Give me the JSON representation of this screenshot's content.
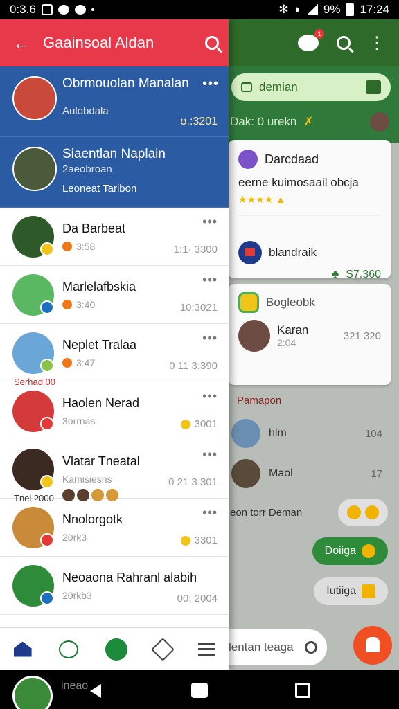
{
  "status_bar": {
    "time_left": "0:3.6",
    "battery_percent": "9%",
    "time_right": "17:24"
  },
  "drawer": {
    "title": "Gaainsoal Aldan",
    "highlighted": [
      {
        "name": "Obrmouolan Manalan",
        "sub": "Aulobdala",
        "meta": "ʊ.:3201"
      },
      {
        "name": "Siaentlan Naplain",
        "sub": "2aeobroan",
        "sub2": "Leoneat Taribon"
      }
    ],
    "items": [
      {
        "name": "Da Barbeat",
        "sub": "3:58",
        "time": "1:1· 3300"
      },
      {
        "name": "Marlelafbskia",
        "sub": "3:40",
        "time": "10:3021"
      },
      {
        "name": "Neplet Tralaa",
        "sub": "3:47",
        "time": "0 11 3:390",
        "tag": "Serhad 00"
      },
      {
        "name": "Haolen Nerad",
        "sub": "3orrnas",
        "time": "3001"
      },
      {
        "name": "Vlatar Tneatal",
        "sub": "Kamisiesns",
        "time": "0 21 3 301",
        "tag": "Tnel 2000"
      },
      {
        "name": "Nnolorgotk",
        "sub": "20rk3",
        "time": "3301"
      },
      {
        "name": "Neoaona Rahranl alabih",
        "sub": "20rkb3",
        "time": "00: 2004"
      }
    ]
  },
  "background_app": {
    "pill_label": "demian",
    "subtitle": "Dak: 0 urekn",
    "card1": {
      "title": "Darcdaad",
      "text": "eerne kuimosaail obcja",
      "row2_label": "blandraik",
      "amount": "S7.360"
    },
    "card2": {
      "title": "Bogleobk",
      "name": "Karan",
      "sub": "2:04",
      "amount": "321 320"
    },
    "section": "Pamapon",
    "rows": [
      {
        "name": "hlm",
        "num": "104"
      },
      {
        "name": "Maol",
        "num": "17"
      }
    ],
    "message": "eon torr Deman",
    "chip_green": "Doiiga",
    "chip_gray": "Iutiiga",
    "search_placeholder": "lentan teaga",
    "badge_count": "1"
  },
  "nav_bar": {
    "label": "ineao"
  },
  "colors": {
    "drawer_header": "#e8394b",
    "highlight_blue": "#2a5ba3",
    "bg_header": "#2e6b2a",
    "fab": "#f04e23"
  }
}
